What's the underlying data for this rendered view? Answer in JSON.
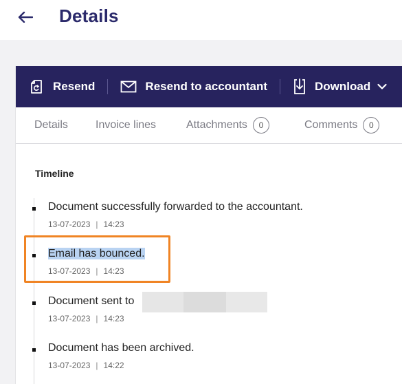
{
  "header": {
    "title": "Details"
  },
  "toolbar": {
    "resend_label": "Resend",
    "resend_accountant_label": "Resend to accountant",
    "download_label": "Download"
  },
  "tabs": [
    {
      "label": "Details"
    },
    {
      "label": "Invoice lines"
    },
    {
      "label": "Attachments",
      "count": "0"
    },
    {
      "label": "Comments",
      "count": "0"
    }
  ],
  "timeline": {
    "title": "Timeline",
    "events": [
      {
        "text": "Document successfully forwarded to the accountant.",
        "date": "13-07-2023",
        "time": "14:23"
      },
      {
        "text": "Email has bounced.",
        "date": "13-07-2023",
        "time": "14:23"
      },
      {
        "text": "Document sent to",
        "date": "13-07-2023",
        "time": "14:23"
      },
      {
        "text": "Document has been archived.",
        "date": "13-07-2023",
        "time": "14:22"
      }
    ]
  },
  "colors": {
    "primary": "#27235e",
    "highlight_box": "#f08424",
    "text_highlight": "#b9d3f2"
  }
}
